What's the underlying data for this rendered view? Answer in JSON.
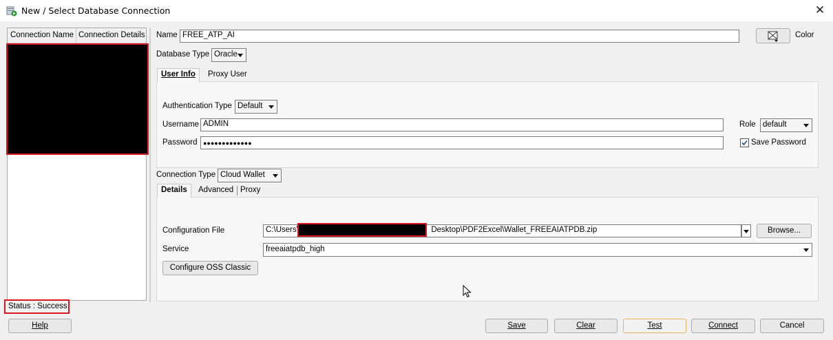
{
  "window": {
    "title": "New / Select Database Connection"
  },
  "connection_list": {
    "columns": [
      "Connection Name",
      "Connection Details"
    ],
    "status": "Status : Success"
  },
  "form": {
    "name_label": "Name",
    "name_value": "FREE_ATP_AI",
    "color_label": "Color",
    "db_type_label": "Database Type",
    "db_type_value": "Oracle",
    "user_tabs": [
      "User Info",
      "Proxy User"
    ],
    "auth_type_label": "Authentication Type",
    "auth_type_value": "Default",
    "username_label": "Username",
    "username_value": "ADMIN",
    "password_label": "Password",
    "password_value": "●●●●●●●●●●●●●",
    "role_label": "Role",
    "role_value": "default",
    "save_password_label": "Save Password",
    "save_password_checked": true,
    "conn_type_label": "Connection Type",
    "conn_type_value": "Cloud Wallet",
    "detail_tabs": [
      "Details",
      "Advanced",
      "Proxy"
    ],
    "config_file_label": "Configuration File",
    "config_file_prefix": "C:\\Users\\",
    "config_file_suffix": "Desktop\\PDF2Excel\\Wallet_FREEAIATPDB.zip",
    "browse_label": "Browse...",
    "service_label": "Service",
    "service_value": "freeaiatpdb_high",
    "configure_oss_label": "Configure OSS Classic"
  },
  "footer": {
    "help": "Help",
    "save": "Save",
    "clear": "Clear",
    "test": "Test",
    "connect": "Connect",
    "cancel": "Cancel"
  }
}
